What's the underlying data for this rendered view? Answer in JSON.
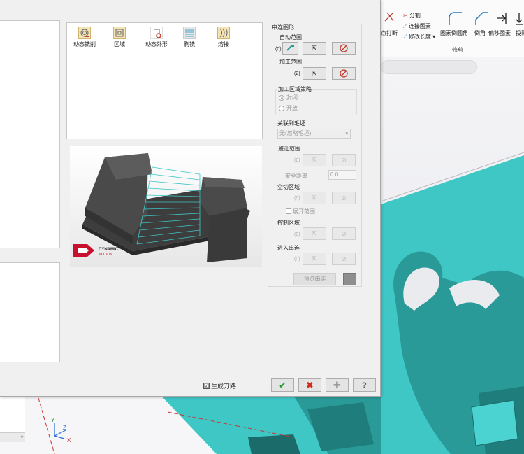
{
  "ribbon": {
    "split_label": "分割",
    "join_label": "连接图素",
    "point_break_label": "点打断",
    "modify_length_label": "修改长度",
    "fillet_label": "图素倒圆角",
    "chamfer_label": "倒角",
    "offset_label": "偏移图素",
    "project_label": "投影",
    "group_label": "修剪"
  },
  "strategies": [
    {
      "label": "动态铣削",
      "icon": "dynamic-mill-icon"
    },
    {
      "label": "区域",
      "icon": "area-icon"
    },
    {
      "label": "动态外形",
      "icon": "dynamic-contour-icon"
    },
    {
      "label": "剥铣",
      "icon": "peel-mill-icon"
    },
    {
      "label": "熔接",
      "icon": "blend-icon"
    }
  ],
  "logo": {
    "line1": "DYNAMIC",
    "line2": "MOTION"
  },
  "settings": {
    "section_title": "串连图形",
    "auto_range": {
      "label": "自动范围",
      "count": "(0)"
    },
    "machining_range": {
      "label": "加工范围",
      "count": "(2)"
    },
    "region_strategy": {
      "label": "加工区域策略",
      "option_closed": "封闭",
      "option_open": "开放"
    },
    "stock_link": {
      "label": "关联到毛坯",
      "value": "无(忽略毛坯)"
    },
    "avoid_range": {
      "label": "避让范围",
      "count": "(0)"
    },
    "safe_distance": {
      "label": "安全距离",
      "value": "0.0"
    },
    "air_cut_region": {
      "label": "空切区域",
      "count": "(0)",
      "expand_label": "展开范围"
    },
    "control_region": {
      "label": "控制区域",
      "count": "(0)"
    },
    "entry_chain": {
      "label": "进入串连",
      "count": "(0)"
    },
    "preview_chain_label": "预览串连"
  },
  "footer": {
    "generate_toolpath_label": "生成刀路",
    "generate_toolpath_checked": "☑"
  },
  "colors": {
    "accent_teal": "#3fc7c6",
    "dialog_bg": "#f0f0f0"
  }
}
